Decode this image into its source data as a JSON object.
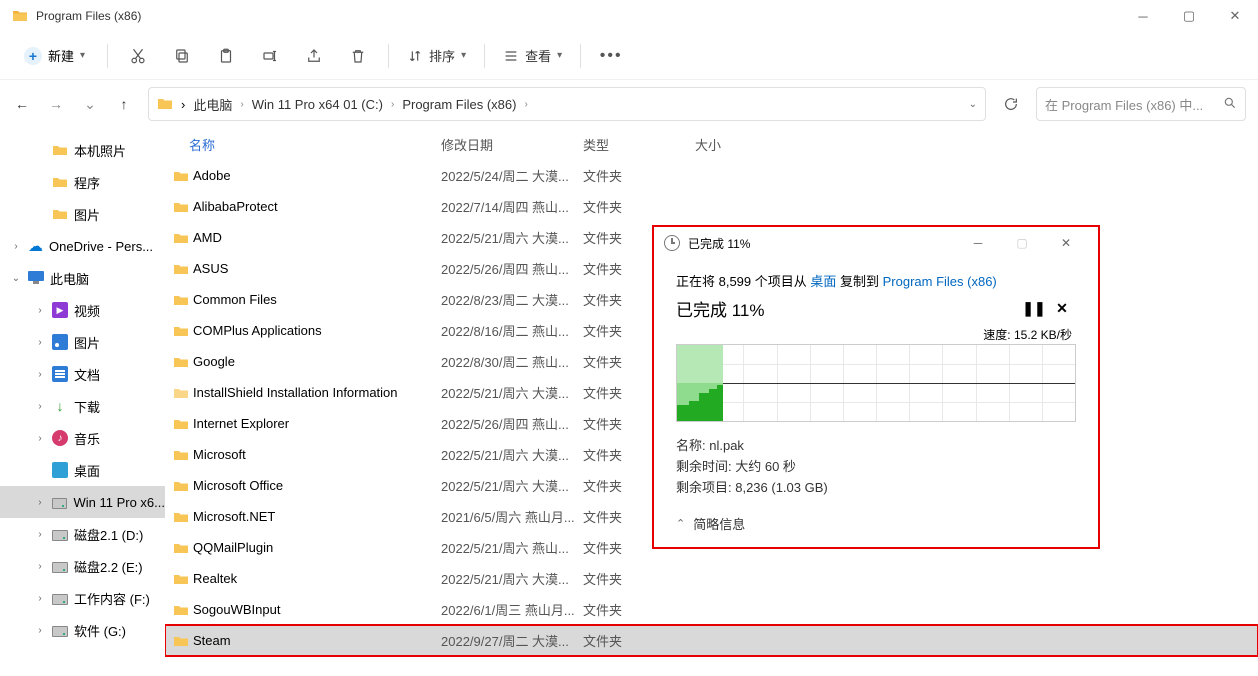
{
  "window": {
    "title": "Program Files (x86)"
  },
  "toolbar": {
    "new_label": "新建",
    "clipboard_icons": [
      "cut",
      "copy",
      "paste",
      "rename",
      "share",
      "delete"
    ],
    "sort_label": "排序",
    "view_label": "查看"
  },
  "breadcrumbs": [
    "此电脑",
    "Win 11 Pro x64 01 (C:)",
    "Program Files (x86)"
  ],
  "search": {
    "placeholder": "在 Program Files (x86) 中..."
  },
  "tree": [
    {
      "label": "本机照片",
      "kind": "folder",
      "depth": 1
    },
    {
      "label": "程序",
      "kind": "folder",
      "depth": 1
    },
    {
      "label": "图片",
      "kind": "folder",
      "depth": 1
    },
    {
      "label": "OneDrive - Pers...",
      "kind": "cloud",
      "depth": 0,
      "expander": "closed"
    },
    {
      "label": "此电脑",
      "kind": "pc",
      "depth": 0,
      "expander": "open"
    },
    {
      "label": "视频",
      "kind": "video",
      "depth": 1,
      "expander": "closed"
    },
    {
      "label": "图片",
      "kind": "image",
      "depth": 1,
      "expander": "closed"
    },
    {
      "label": "文档",
      "kind": "doc",
      "depth": 1,
      "expander": "closed"
    },
    {
      "label": "下载",
      "kind": "download",
      "depth": 1,
      "expander": "closed"
    },
    {
      "label": "音乐",
      "kind": "music",
      "depth": 1,
      "expander": "closed"
    },
    {
      "label": "桌面",
      "kind": "desktop",
      "depth": 1
    },
    {
      "label": "Win 11 Pro x6...",
      "kind": "drive",
      "depth": 1,
      "highlighted": true,
      "expander": "closed"
    },
    {
      "label": "磁盘2.1 (D:)",
      "kind": "drive",
      "depth": 1,
      "expander": "closed"
    },
    {
      "label": "磁盘2.2 (E:)",
      "kind": "drive",
      "depth": 1,
      "expander": "closed"
    },
    {
      "label": "工作内容 (F:)",
      "kind": "drive",
      "depth": 1,
      "expander": "closed"
    },
    {
      "label": "软件 (G:)",
      "kind": "drive",
      "depth": 1,
      "expander": "closed"
    }
  ],
  "columns": {
    "name": "名称",
    "date": "修改日期",
    "type": "类型",
    "size": "大小"
  },
  "type_folder": "文件夹",
  "files": [
    {
      "name": "Adobe",
      "date": "2022/5/24/周二 大漠...",
      "type": "文件夹"
    },
    {
      "name": "AlibabaProtect",
      "date": "2022/7/14/周四 燕山...",
      "type": "文件夹"
    },
    {
      "name": "AMD",
      "date": "2022/5/21/周六 大漠...",
      "type": "文件夹"
    },
    {
      "name": "ASUS",
      "date": "2022/5/26/周四 燕山...",
      "type": "文件夹"
    },
    {
      "name": "Common Files",
      "date": "2022/8/23/周二 大漠...",
      "type": "文件夹"
    },
    {
      "name": "COMPlus Applications",
      "date": "2022/8/16/周二 燕山...",
      "type": "文件夹"
    },
    {
      "name": "Google",
      "date": "2022/8/30/周二 燕山...",
      "type": "文件夹"
    },
    {
      "name": "InstallShield Installation Information",
      "date": "2022/5/21/周六 大漠...",
      "type": "文件夹",
      "faded": true
    },
    {
      "name": "Internet Explorer",
      "date": "2022/5/26/周四 燕山...",
      "type": "文件夹"
    },
    {
      "name": "Microsoft",
      "date": "2022/5/21/周六 大漠...",
      "type": "文件夹"
    },
    {
      "name": "Microsoft Office",
      "date": "2022/5/21/周六 大漠...",
      "type": "文件夹"
    },
    {
      "name": "Microsoft.NET",
      "date": "2021/6/5/周六 燕山月...",
      "type": "文件夹"
    },
    {
      "name": "QQMailPlugin",
      "date": "2022/5/21/周六 燕山...",
      "type": "文件夹"
    },
    {
      "name": "Realtek",
      "date": "2022/5/21/周六 大漠...",
      "type": "文件夹"
    },
    {
      "name": "SogouWBInput",
      "date": "2022/6/1/周三 燕山月...",
      "type": "文件夹"
    },
    {
      "name": "Steam",
      "date": "2022/9/27/周二 大漠...",
      "type": "文件夹",
      "selected": true,
      "redbox": true
    }
  ],
  "dialog": {
    "title": "已完成 11%",
    "status_prefix": "正在将 8,599 个项目从 ",
    "status_src": "桌面",
    "status_mid": " 复制到 ",
    "status_dst": "Program Files (x86)",
    "headline": "已完成 11%",
    "speed_label": "速度: 15.2 KB/秒",
    "meta_name_label": "名称: ",
    "meta_name": "nl.pak",
    "meta_time_label": "剩余时间: ",
    "meta_time": "大约 60 秒",
    "meta_items_label": "剩余项目: ",
    "meta_items": "8,236 (1.03 GB)",
    "footer": "简略信息"
  },
  "chart_data": {
    "type": "area",
    "title": "",
    "xlabel": "",
    "ylabel": "",
    "progress_percent": 11,
    "x_range_seconds": [
      0,
      100
    ],
    "series": [
      {
        "name": "speed_kbps",
        "x": [
          0,
          2,
          4,
          6,
          8,
          10,
          11
        ],
        "values": [
          4,
          6,
          6,
          12,
          12,
          14,
          15.2
        ]
      }
    ],
    "ylim": [
      0,
      30
    ],
    "speed_current": "15.2 KB/秒"
  }
}
